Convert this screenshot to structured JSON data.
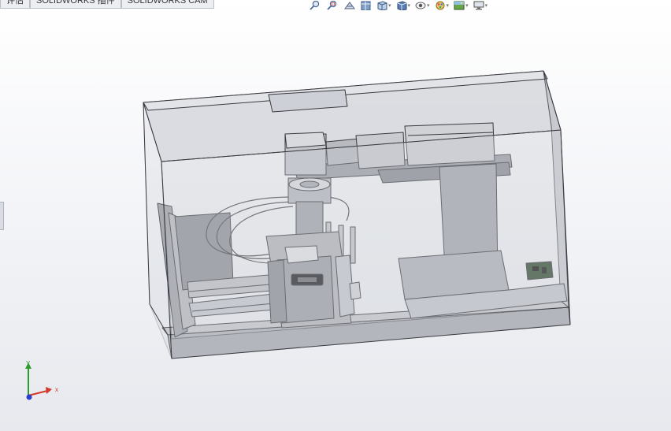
{
  "tabs": [
    {
      "label": "评估"
    },
    {
      "label": "SOLIDWORKS 插件"
    },
    {
      "label": "SOLIDWORKS CAM"
    }
  ],
  "view_toolbar": [
    {
      "icon": "zoom-to-fit-icon"
    },
    {
      "icon": "zoom-to-area-icon"
    },
    {
      "icon": "previous-view-icon"
    },
    {
      "icon": "section-view-icon"
    },
    {
      "icon": "view-orientation-icon"
    },
    {
      "icon": "display-style-icon"
    },
    {
      "icon": "hide-show-items-icon"
    },
    {
      "icon": "edit-appearance-icon"
    },
    {
      "icon": "apply-scene-icon"
    },
    {
      "icon": "view-settings-icon"
    }
  ],
  "triad": {
    "x_label": "x",
    "y_label": "Y"
  },
  "colors": {
    "enclosure": "#c9ccd2",
    "machine": "#a8aab2",
    "edge": "#3a3a40",
    "board": "#2f4a2c"
  }
}
